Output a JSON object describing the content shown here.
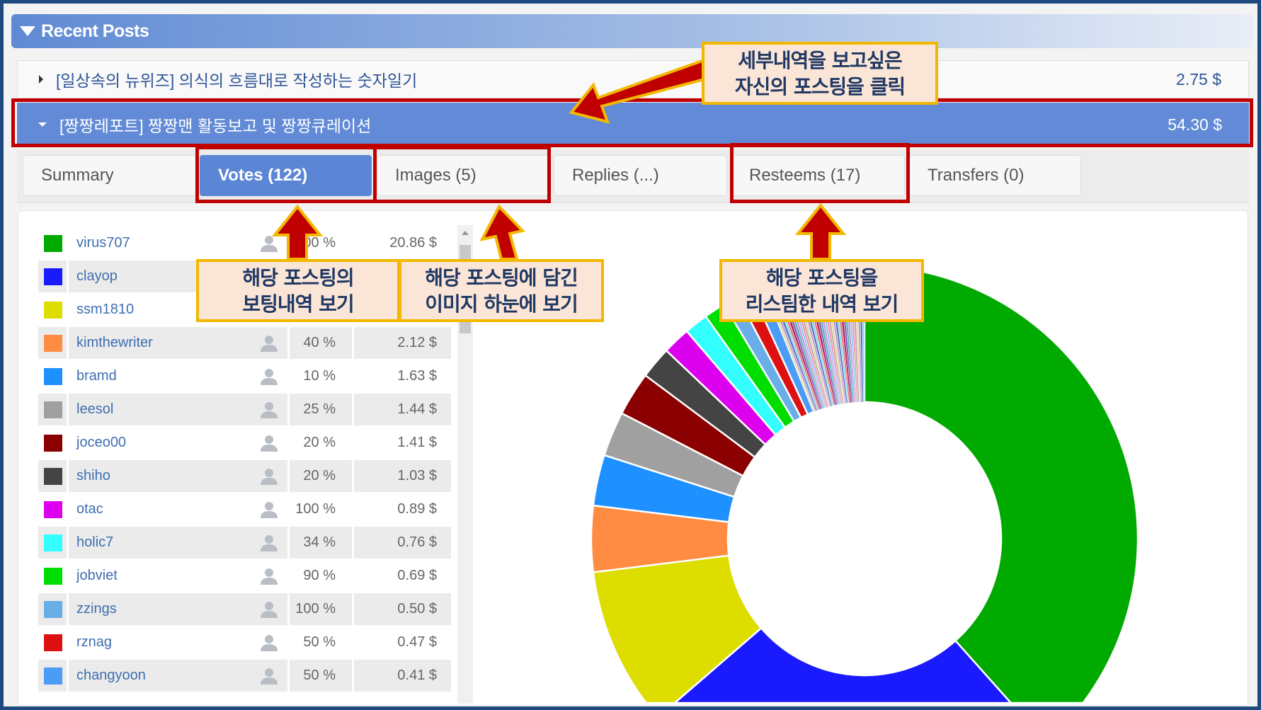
{
  "section": {
    "title": "Recent Posts"
  },
  "posts": [
    {
      "title": "[일상속의 뉴위즈] 의식의 흐름대로 작성하는 숫자일기",
      "amount": "2.75 $",
      "expanded": false
    },
    {
      "title": "[짱짱레포트] 짱짱맨 활동보고 및 짱짱큐레이션",
      "amount": "54.30 $",
      "expanded": true
    }
  ],
  "tabs": [
    {
      "label": "Summary",
      "active": false
    },
    {
      "label": "Votes (122)",
      "active": true
    },
    {
      "label": "Images (5)",
      "active": false
    },
    {
      "label": "Replies (...)",
      "active": false
    },
    {
      "label": "Resteems (17)",
      "active": false
    },
    {
      "label": "Transfers (0)",
      "active": false
    }
  ],
  "votes": [
    {
      "name": "virus707",
      "percent": "100 %",
      "amount": "20.86 $",
      "color": "#00aa00"
    },
    {
      "name": "clayop",
      "percent": "",
      "amount": "",
      "color": "#1a1aff"
    },
    {
      "name": "ssm1810",
      "percent": "",
      "amount": "",
      "color": "#dddd00"
    },
    {
      "name": "kimthewriter",
      "percent": "40 %",
      "amount": "2.12 $",
      "color": "#ff8c42"
    },
    {
      "name": "bramd",
      "percent": "10 %",
      "amount": "1.63 $",
      "color": "#1e90ff"
    },
    {
      "name": "leesol",
      "percent": "25 %",
      "amount": "1.44 $",
      "color": "#a0a0a0"
    },
    {
      "name": "joceo00",
      "percent": "20 %",
      "amount": "1.41 $",
      "color": "#8b0000"
    },
    {
      "name": "shiho",
      "percent": "20 %",
      "amount": "1.03 $",
      "color": "#444444"
    },
    {
      "name": "otac",
      "percent": "100 %",
      "amount": "0.89 $",
      "color": "#dd00ee"
    },
    {
      "name": "holic7",
      "percent": "34 %",
      "amount": "0.76 $",
      "color": "#33ffff"
    },
    {
      "name": "jobviet",
      "percent": "90 %",
      "amount": "0.69 $",
      "color": "#00dd00"
    },
    {
      "name": "zzings",
      "percent": "100 %",
      "amount": "0.50 $",
      "color": "#6aaee8"
    },
    {
      "name": "rznag",
      "percent": "50 %",
      "amount": "0.47 $",
      "color": "#dd1111"
    },
    {
      "name": "changyoon",
      "percent": "50 %",
      "amount": "0.41 $",
      "color": "#4a9cf5"
    }
  ],
  "chart_data": {
    "type": "pie",
    "style": "donut",
    "categories": [
      "virus707",
      "clayop",
      "ssm1810",
      "kimthewriter",
      "bramd",
      "leesol",
      "joceo00",
      "shiho",
      "otac",
      "holic7",
      "jobviet",
      "zzings",
      "rznag",
      "changyoon"
    ],
    "values": [
      20.86,
      13.7,
      5.1,
      2.12,
      1.63,
      1.44,
      1.41,
      1.03,
      0.89,
      0.76,
      0.69,
      0.5,
      0.47,
      0.41
    ],
    "remaining_value": 3.29,
    "total": 54.3
  },
  "annotations": {
    "click_post": [
      "세부내역을 보고싶은",
      "자신의 포스팅을 클릭"
    ],
    "votes": [
      "해당 포스팅의",
      "보팅내역 보기"
    ],
    "images": [
      "해당 포스팅에 담긴",
      "이미지 하눈에 보기"
    ],
    "resteems": [
      "해당 포스팅을",
      "리스팀한 내역 보기"
    ]
  }
}
